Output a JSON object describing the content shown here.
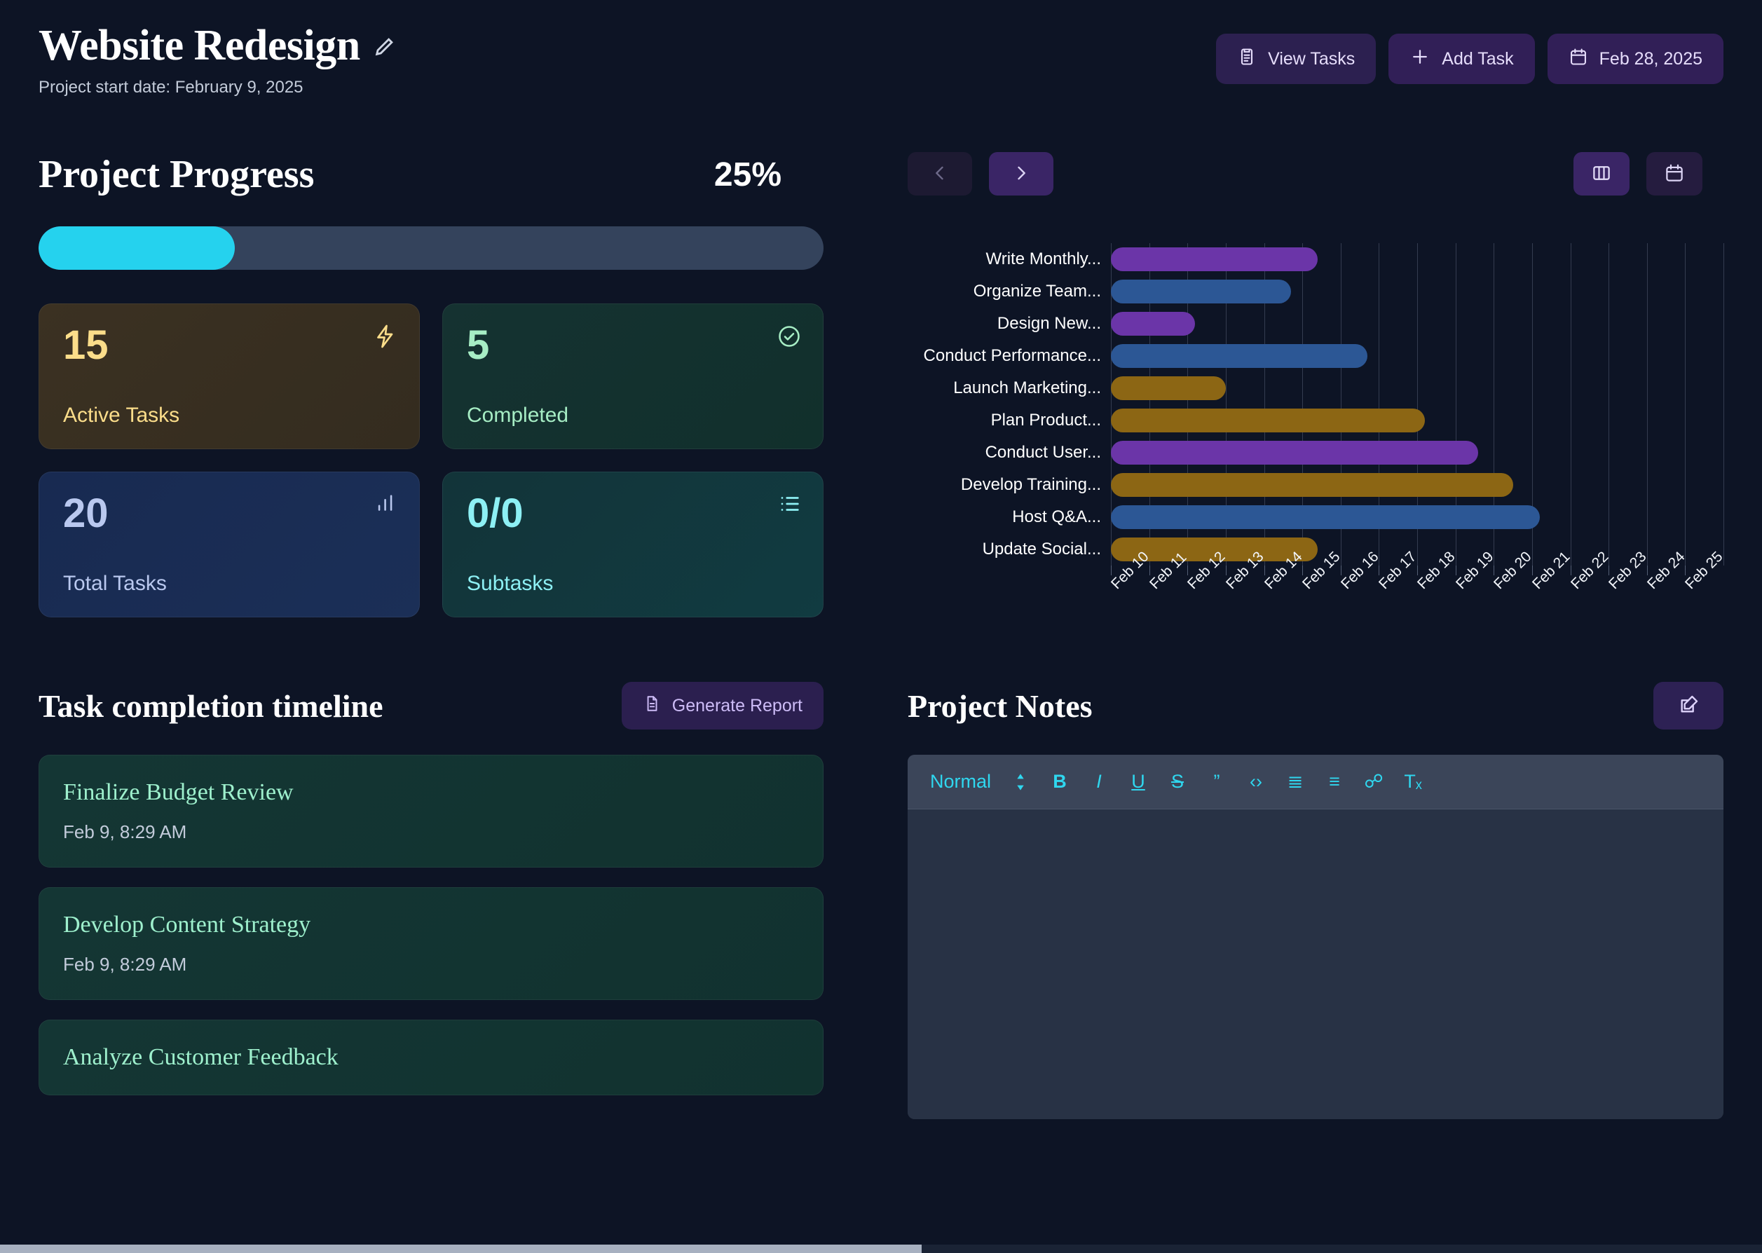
{
  "header": {
    "title": "Website Redesign",
    "edit_icon": "pencil-icon",
    "start_date": "Project start date: February 9, 2025",
    "buttons": [
      {
        "label": "View Tasks",
        "icon": "clipboard-icon"
      },
      {
        "label": "Add Task",
        "icon": "plus-icon"
      },
      {
        "label": "Feb 28, 2025",
        "icon": "calendar-icon"
      }
    ]
  },
  "progress": {
    "title": "Project Progress",
    "percent_label": "25%",
    "percent_value": 25
  },
  "stats": [
    {
      "value": "15",
      "label": "Active Tasks",
      "icon": "lightning-icon",
      "theme": "card-amber"
    },
    {
      "value": "5",
      "label": "Completed",
      "icon": "check-circle-icon",
      "theme": "card-green"
    },
    {
      "value": "20",
      "label": "Total Tasks",
      "icon": "bar-chart-icon",
      "theme": "card-blue"
    },
    {
      "value": "0/0",
      "label": "Subtasks",
      "icon": "list-icon",
      "theme": "card-teal"
    }
  ],
  "gantt_toolbar": {
    "prev_icon": "chevron-left-icon",
    "next_icon": "chevron-right-icon",
    "board_icon": "columns-icon",
    "calendar_icon": "calendar-icon"
  },
  "chart_data": {
    "type": "bar",
    "title": "",
    "xlabel": "",
    "ylabel": "",
    "grid": true,
    "legend": "none",
    "orientation": "horizontal",
    "x_tick_labels": [
      "Feb 10",
      "Feb 11",
      "Feb 12",
      "Feb 13",
      "Feb 14",
      "Feb 15",
      "Feb 16",
      "Feb 17",
      "Feb 18",
      "Feb 19",
      "Feb 20",
      "Feb 21",
      "Feb 22",
      "Feb 23",
      "Feb 24",
      "Feb 25"
    ],
    "xlim": [
      0,
      16
    ],
    "colors": {
      "purple": "#6b35a8",
      "blue": "#2c5795",
      "gold": "#8c6614"
    },
    "categories": [
      "Write Monthly...",
      "Organize Team...",
      "Design New...",
      "Conduct Performance...",
      "Launch Marketing...",
      "Plan Product...",
      "Conduct User...",
      "Develop Training...",
      "Host Q&A...",
      "Update Social..."
    ],
    "values": [
      5.4,
      4.7,
      2.2,
      6.7,
      3.0,
      8.2,
      9.6,
      10.5,
      11.2,
      5.4
    ],
    "bars": [
      {
        "label": "Write Monthly...",
        "start": 0,
        "end": 5.4,
        "color": "#6b35a8"
      },
      {
        "label": "Organize Team...",
        "start": 0,
        "end": 4.7,
        "color": "#2c5795"
      },
      {
        "label": "Design New...",
        "start": 0,
        "end": 2.2,
        "color": "#6b35a8"
      },
      {
        "label": "Conduct Performance...",
        "start": 0,
        "end": 6.7,
        "color": "#2c5795"
      },
      {
        "label": "Launch Marketing...",
        "start": 0,
        "end": 3.0,
        "color": "#8c6614"
      },
      {
        "label": "Plan Product...",
        "start": 0,
        "end": 8.2,
        "color": "#8c6614"
      },
      {
        "label": "Conduct User...",
        "start": 0,
        "end": 9.6,
        "color": "#6b35a8"
      },
      {
        "label": "Develop Training...",
        "start": 0,
        "end": 10.5,
        "color": "#8c6614"
      },
      {
        "label": "Host Q&A...",
        "start": 0,
        "end": 11.2,
        "color": "#2c5795"
      },
      {
        "label": "Update Social...",
        "start": 0,
        "end": 5.4,
        "color": "#8c6614"
      }
    ]
  },
  "timeline": {
    "title": "Task completion timeline",
    "report_button": "Generate Report",
    "report_icon": "document-icon",
    "items": [
      {
        "title": "Finalize Budget Review",
        "date": "Feb 9, 8:29 AM"
      },
      {
        "title": "Develop Content Strategy",
        "date": "Feb 9, 8:29 AM"
      },
      {
        "title": "Analyze Customer Feedback",
        "date": ""
      }
    ]
  },
  "notes": {
    "title": "Project Notes",
    "edit_icon": "edit-square-icon",
    "toolbar": {
      "style_label": "Normal",
      "stepper_icon": "updown-arrows-icon",
      "buttons": [
        {
          "name": "bold",
          "glyph": "B"
        },
        {
          "name": "italic",
          "glyph": "I"
        },
        {
          "name": "underline",
          "glyph": "U"
        },
        {
          "name": "strikethrough",
          "glyph": "S"
        },
        {
          "name": "blockquote",
          "glyph": "”"
        },
        {
          "name": "code-block",
          "glyph": "‹›"
        },
        {
          "name": "ordered-list",
          "glyph": "≣"
        },
        {
          "name": "bullet-list",
          "glyph": "≡"
        },
        {
          "name": "link",
          "glyph": "☍"
        },
        {
          "name": "clear-format",
          "glyph": "Tₓ"
        }
      ]
    },
    "body_text": ""
  }
}
